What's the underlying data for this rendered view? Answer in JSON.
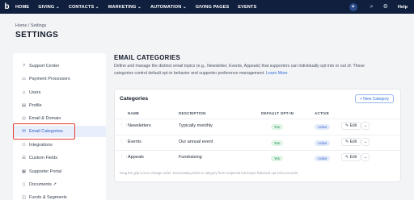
{
  "topnav": {
    "logo": "b",
    "items": [
      {
        "label": "HOME"
      },
      {
        "label": "GIVING ⌄"
      },
      {
        "label": "CONTACTS ⌄"
      },
      {
        "label": "MARKETING ⌄"
      },
      {
        "label": "AUTOMATION ⌄"
      },
      {
        "label": "GIVING PAGES"
      },
      {
        "label": "EVENTS"
      }
    ],
    "bubble_icon": "sparkle-icon",
    "search_icon": "search-icon",
    "settings_icon": "gear-icon",
    "help_label": "Help"
  },
  "header": {
    "breadcrumb": "Home  /  Settings",
    "title": "SETTINGS"
  },
  "sidebar": {
    "items": [
      {
        "label": "Support Center",
        "icon": "question-icon"
      },
      {
        "label": "Payment Processors",
        "icon": "card-icon"
      },
      {
        "label": "Users",
        "icon": "user-icon"
      },
      {
        "label": "Profile",
        "icon": "profile-icon"
      },
      {
        "label": "Email & Domain",
        "icon": "globe-icon"
      },
      {
        "label": "Email Categories",
        "icon": "mail-icon",
        "active": true
      },
      {
        "label": "Integrations",
        "icon": "plug-icon"
      },
      {
        "label": "Custom Fields",
        "icon": "fields-icon"
      },
      {
        "label": "Supporter Portal",
        "icon": "portal-icon"
      },
      {
        "label": "Documents ↗",
        "icon": "document-icon"
      },
      {
        "label": "Funds & Segments",
        "icon": "funds-icon"
      }
    ]
  },
  "main": {
    "title": "EMAIL CATEGORIES",
    "description": "Define and manage the distinct email topics (e.g., Newsletter, Events, Appeals) that supporters can individually opt into or out of. These categories control default opt-in behavior and supporter preference management.",
    "learn_more": "Learn More",
    "card": {
      "title": "Categories",
      "new_button": "+ New Category",
      "columns": [
        "NAME",
        "DESCRIPTION",
        "DEFAULT OPT-IN",
        "ACTIVE"
      ],
      "rows": [
        {
          "name": "Newsletters",
          "description": "Typically monthly",
          "default_opt_in": "Yes",
          "active": "Active"
        },
        {
          "name": "Events",
          "description": "Our annual event",
          "default_opt_in": "Yes",
          "active": "Active"
        },
        {
          "name": "Appeals",
          "description": "Fundraising",
          "default_opt_in": "Yes",
          "active": "Active"
        }
      ],
      "edit_label": "✎ Edit",
      "more_label": "⌄",
      "footer_note": "Drag the grip icon to change order. Deactivating hides a category from recipients but keeps historical opt-in/out records."
    }
  }
}
